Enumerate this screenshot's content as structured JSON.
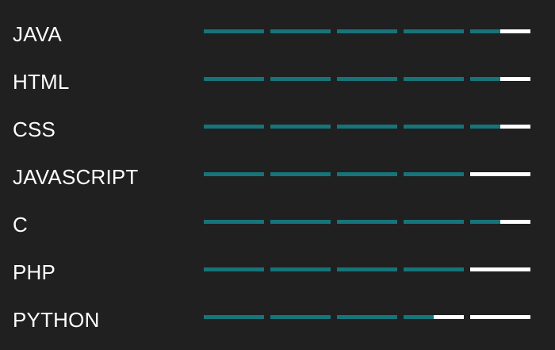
{
  "colors": {
    "background": "#202020",
    "text": "#ffffff",
    "filled": "#16747a",
    "empty": "#ffffff"
  },
  "segments_per_meter": 5,
  "skills": [
    {
      "name": "JAVA",
      "level": 0.9
    },
    {
      "name": "HTML",
      "level": 0.9
    },
    {
      "name": "CSS",
      "level": 0.9
    },
    {
      "name": "JAVASCRIPT",
      "level": 0.8
    },
    {
      "name": "C",
      "level": 0.9
    },
    {
      "name": "PHP",
      "level": 0.8
    },
    {
      "name": "PYTHON",
      "level": 0.7
    }
  ]
}
